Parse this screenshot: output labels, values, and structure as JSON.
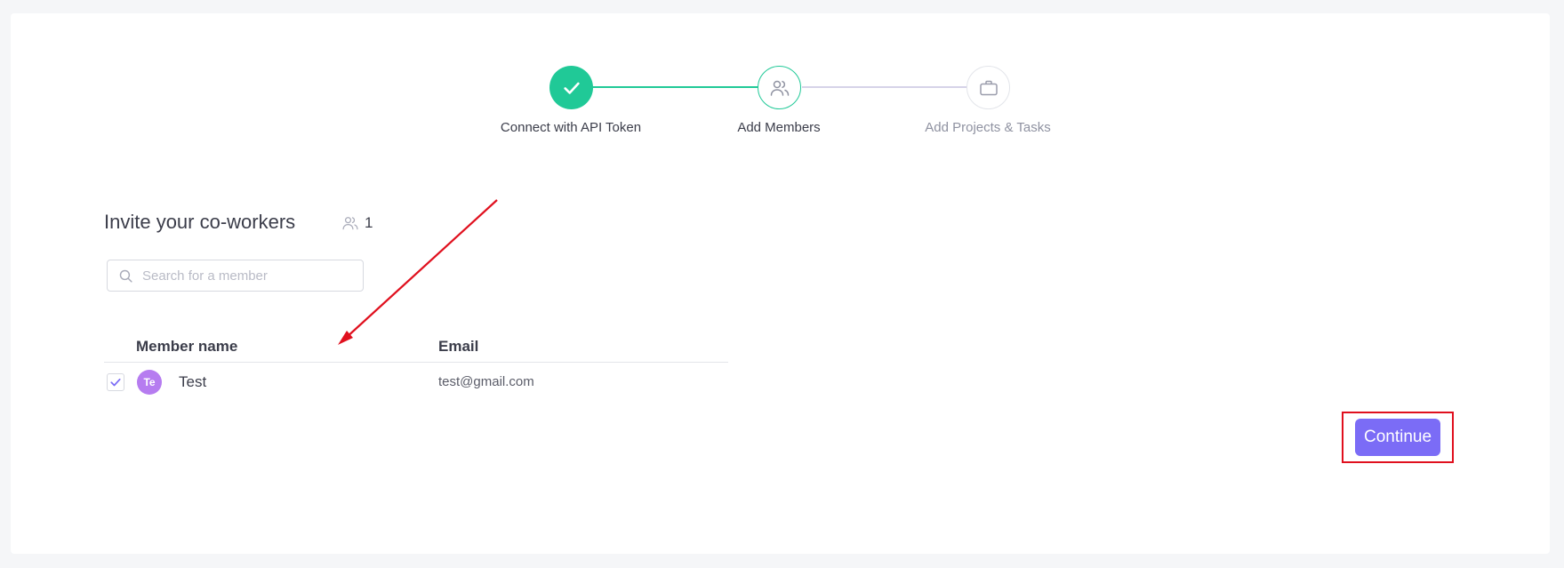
{
  "stepper": {
    "steps": [
      {
        "label": "Connect with API Token",
        "state": "completed",
        "icon": "check-icon"
      },
      {
        "label": "Add Members",
        "state": "active",
        "icon": "users-icon"
      },
      {
        "label": "Add Projects & Tasks",
        "state": "pending",
        "icon": "briefcase-icon"
      }
    ]
  },
  "invite": {
    "title": "Invite your co-workers",
    "member_count": "1",
    "count_icon": "users-icon"
  },
  "search": {
    "placeholder": "Search for a member",
    "value": "",
    "icon": "search-icon"
  },
  "table": {
    "columns": [
      "Member name",
      "Email"
    ],
    "rows": [
      {
        "checked": true,
        "avatar_initials": "Te",
        "name": "Test",
        "email": "test@gmail.com"
      }
    ]
  },
  "actions": {
    "continue_label": "Continue"
  },
  "colors": {
    "success": "#20c997",
    "accent": "#7b6cf6",
    "highlight": "#e0101e",
    "avatar": "#b67cf0",
    "text_dark": "#3b3d4a",
    "text_muted": "#8f92a1",
    "line_pending": "#d6d3e8"
  }
}
